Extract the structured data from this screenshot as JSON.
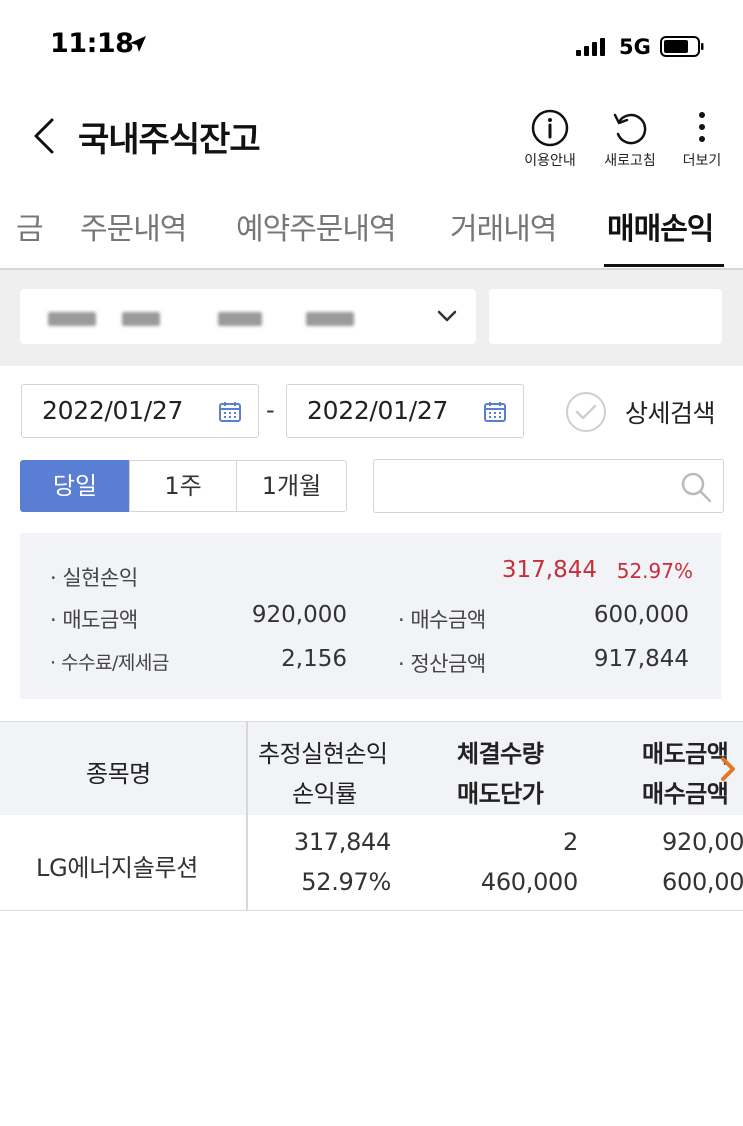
{
  "status_bar": {
    "time": "11:18",
    "network": "5G"
  },
  "header": {
    "title": "국내주식잔고",
    "actions": [
      {
        "label": "이용안내",
        "icon": "info-icon"
      },
      {
        "label": "새로고침",
        "icon": "refresh-icon"
      },
      {
        "label": "더보기",
        "icon": "more-vertical-icon"
      }
    ]
  },
  "tabs": [
    {
      "label": "금",
      "active": false
    },
    {
      "label": "주문내역",
      "active": false
    },
    {
      "label": "예약주문내역",
      "active": false
    },
    {
      "label": "거래내역",
      "active": false
    },
    {
      "label": "매매손익",
      "active": true
    }
  ],
  "filters": {
    "start_date": "2022/01/27",
    "date_separator": "-",
    "end_date": "2022/01/27",
    "detail_search_label": "상세검색",
    "periods": [
      {
        "label": "당일",
        "active": true
      },
      {
        "label": "1주",
        "active": false
      },
      {
        "label": "1개월",
        "active": false
      }
    ]
  },
  "summary": {
    "realized_pl_label": "실현손익",
    "realized_pl_value": "317,844",
    "realized_pl_rate": "52.97%",
    "sell_amount_label": "매도금액",
    "sell_amount_value": "920,000",
    "buy_amount_label": "매수금액",
    "buy_amount_value": "600,000",
    "fee_tax_label": "수수료/제세금",
    "fee_tax_value": "2,156",
    "settlement_label": "정산금액",
    "settlement_value": "917,844"
  },
  "table": {
    "headers": {
      "name": "종목명",
      "est_pl": "추정실현손익",
      "pl_rate": "손익률",
      "exec_qty": "체결수량",
      "sell_price": "매도단가",
      "sell_amount": "매도금액",
      "buy_amount": "매수금액"
    },
    "rows": [
      {
        "name": "LG에너지솔루션",
        "est_pl": "317,844",
        "pl_rate": "52.97%",
        "exec_qty": "2",
        "sell_price": "460,000",
        "sell_amount": "920,00",
        "buy_amount": "600,00"
      }
    ]
  },
  "colors": {
    "accent": "#5a7ed4",
    "profit": "#c62f3a",
    "summary_bg": "#f1f3f6"
  }
}
